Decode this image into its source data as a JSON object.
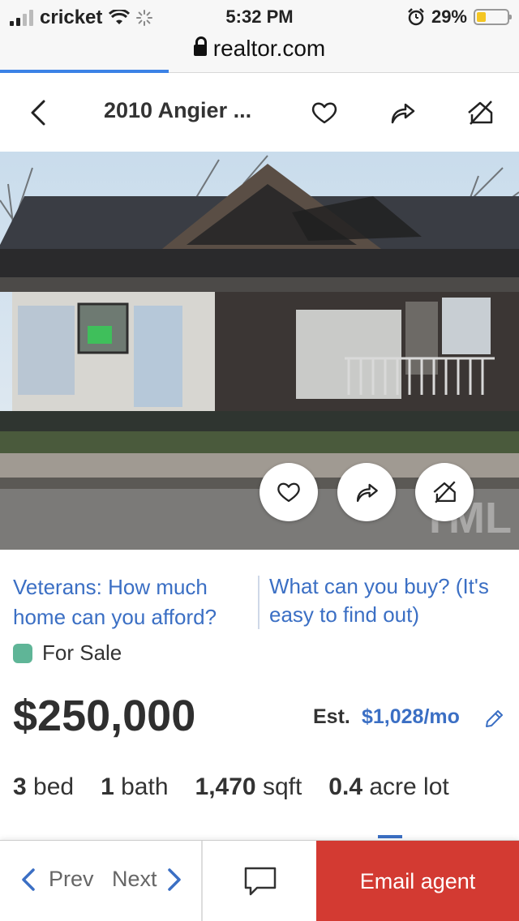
{
  "status_bar": {
    "carrier": "cricket",
    "time": "5:32 PM",
    "battery": "29%"
  },
  "browser": {
    "url": "realtor.com"
  },
  "header": {
    "title": "2010 Angier ..."
  },
  "ads": {
    "left": "Veterans: How much home can you afford?",
    "right": "What can you buy? (It's easy to find out)"
  },
  "listing": {
    "status": "For Sale",
    "price": "$250,000",
    "est_label": "Est.",
    "est_value": "$1,028/mo",
    "facts": [
      {
        "num": "3",
        "unit": "bed"
      },
      {
        "num": "1",
        "unit": "bath"
      },
      {
        "num": "1,470",
        "unit": "sqft"
      },
      {
        "num": "0.4",
        "unit": "acre lot"
      }
    ]
  },
  "bottom_bar": {
    "prev": "Prev",
    "next": "Next",
    "email": "Email agent"
  },
  "colors": {
    "link": "#3b6fc4",
    "status_dot": "#5fb597",
    "cta": "#d33a32"
  }
}
